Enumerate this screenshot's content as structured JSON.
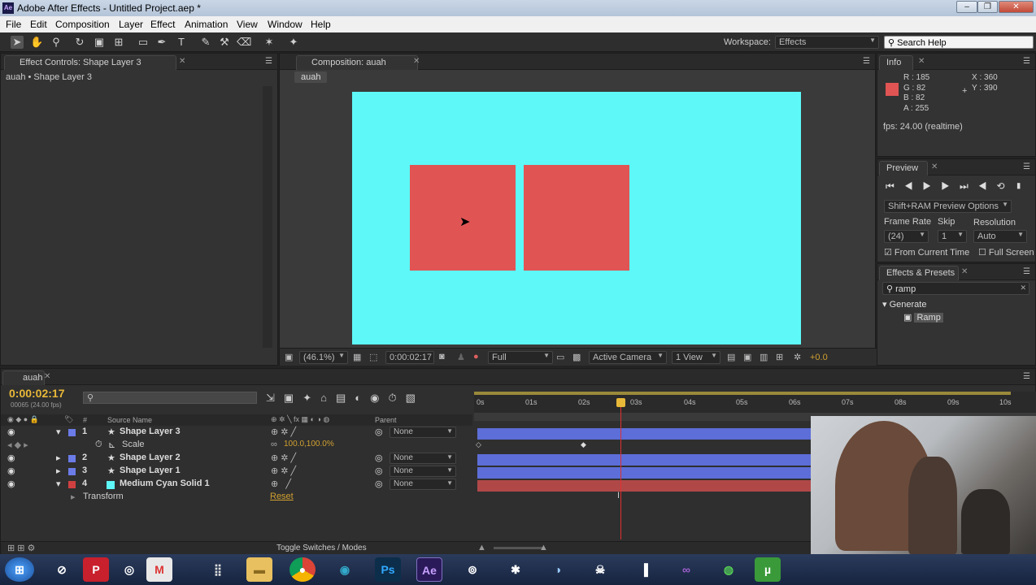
{
  "window": {
    "title": "Adobe After Effects - Untitled Project.aep *",
    "app_icon": "Ae"
  },
  "menu": [
    "File",
    "Edit",
    "Composition",
    "Layer",
    "Effect",
    "Animation",
    "View",
    "Window",
    "Help"
  ],
  "workspace": {
    "label": "Workspace:",
    "value": "Effects"
  },
  "search_help": "Search Help",
  "effect_controls": {
    "tab": "Effect Controls: Shape Layer 3",
    "breadcrumb": "auah • Shape Layer 3"
  },
  "composition": {
    "tab": "Composition: auah",
    "subtab": "auah",
    "bg_color": "#5ef8f8",
    "shape_color": "#e05454",
    "footer": {
      "zoom": "(46.1%)",
      "timecode": "0:00:02:17",
      "resolution": "Full",
      "camera": "Active Camera",
      "views": "1 View",
      "exposure": "+0.0"
    }
  },
  "info": {
    "tab": "Info",
    "r": "R : 185",
    "g": "G : 82",
    "b": "B : 82",
    "a": "A : 255",
    "x": "X : 360",
    "y": "Y : 390",
    "fps": "fps: 24.00 (realtime)",
    "swatch": "#e05454"
  },
  "preview": {
    "tab": "Preview",
    "options": "Shift+RAM Preview Options",
    "frame_rate_label": "Frame Rate",
    "skip_label": "Skip",
    "resolution_label": "Resolution",
    "frame_rate": "(24)",
    "skip": "1",
    "resolution": "Auto",
    "from_current": "From Current Time",
    "full_screen": "Full Screen"
  },
  "effects_presets": {
    "tab": "Effects & Presets",
    "search": "ramp",
    "category": "Generate",
    "item": "Ramp"
  },
  "timeline": {
    "tab": "auah",
    "timecode": "0:00:02:17",
    "frames": "00065 (24.00 fps)",
    "col_num": "#",
    "col_source": "Source Name",
    "col_parent": "Parent",
    "ruler": [
      "0s",
      "01s",
      "02s",
      "03s",
      "04s",
      "05s",
      "06s",
      "07s",
      "08s",
      "09s",
      "10s"
    ],
    "layers": [
      {
        "num": "1",
        "name": "Shape Layer 3",
        "parent": "None",
        "label": "#6b7ce8"
      },
      {
        "num": "2",
        "name": "Shape Layer 2",
        "parent": "None",
        "label": "#6b7ce8"
      },
      {
        "num": "3",
        "name": "Shape Layer 1",
        "parent": "None",
        "label": "#6b7ce8"
      },
      {
        "num": "4",
        "name": "Medium Cyan Solid 1",
        "parent": "None",
        "label": "#d04040"
      }
    ],
    "scale": {
      "label": "Scale",
      "value": "100.0,100.0%"
    },
    "transform": {
      "label": "Transform",
      "reset": "Reset"
    },
    "toggle": "Toggle Switches / Modes"
  }
}
